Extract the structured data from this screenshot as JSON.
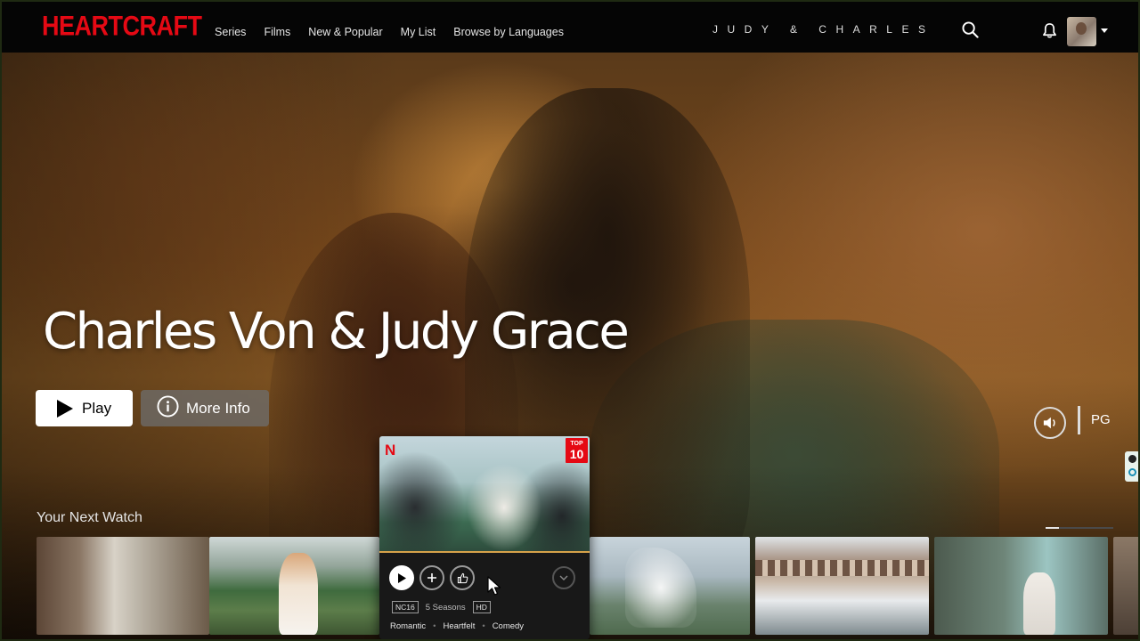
{
  "header": {
    "logo": "HEARTCRAFT",
    "nav": [
      "Series",
      "Films",
      "New & Popular",
      "My List",
      "Browse by Languages"
    ],
    "center_title": "JUDY & CHARLES",
    "icons": [
      "search-icon",
      "bell-icon",
      "avatar",
      "caret-down-icon"
    ]
  },
  "hero": {
    "title": "Charles Von & Judy Grace",
    "play_label": "Play",
    "info_label": "More Info",
    "rating": "PG",
    "mute_icon": "volume-icon"
  },
  "row": {
    "title": "Your Next Watch",
    "page_progress": 0.2
  },
  "card": {
    "badge": "N",
    "top_small": "TOP",
    "top_big": "10",
    "maturity": "NC16",
    "seasons": "5 Seasons",
    "quality": "HD",
    "genres": [
      "Romantic",
      "Heartfelt",
      "Comedy"
    ],
    "accent_color": "#e50914"
  }
}
